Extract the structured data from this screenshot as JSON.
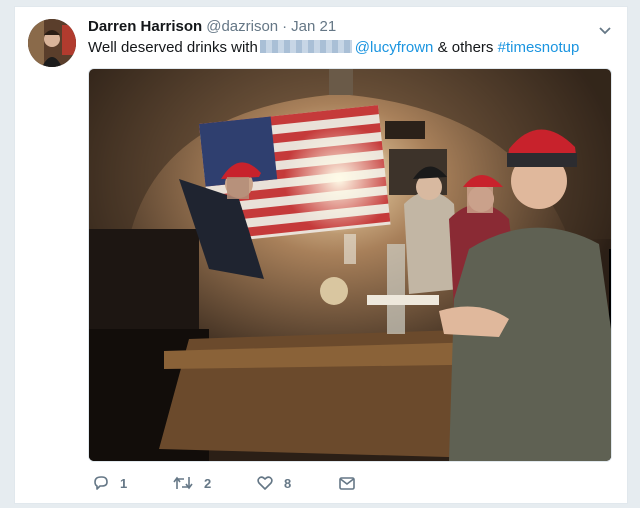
{
  "tweet": {
    "display_name": "Darren Harrison",
    "handle": "@dazrison",
    "separator": "·",
    "date": "Jan 21",
    "text_before": "Well deserved drinks with",
    "mention": "@lucyfrown",
    "text_middle": "& others",
    "hashtag": "#timesnotup"
  },
  "actions": {
    "replies": "1",
    "retweets": "2",
    "likes": "8"
  },
  "icons": {
    "reply": "reply-icon",
    "retweet": "retweet-icon",
    "like": "heart-icon",
    "dm": "envelope-icon",
    "more": "chevron-down-icon"
  },
  "colors": {
    "link": "#1b95e0",
    "muted": "#657786",
    "text": "#14171a",
    "hat_red": "#c8222c"
  }
}
